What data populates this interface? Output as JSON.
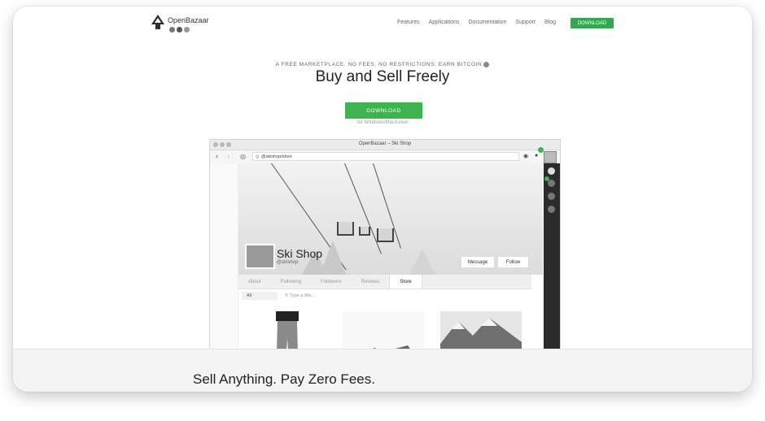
{
  "header": {
    "brand": "OpenBazaar",
    "nav": [
      "Features",
      "Applications",
      "Documentation",
      "Support",
      "Blog"
    ],
    "download_label": "DOWNLOAD"
  },
  "hero": {
    "tagline": "A FREE MARKETPLACE. NO FEES. NO RESTRICTIONS. EARN BITCOIN",
    "title": "Buy and Sell Freely",
    "download_label": "DOWNLOAD",
    "platforms": "for Windows/Mac/Linux"
  },
  "app": {
    "window_title": "OpenBazaar – Ski Shop",
    "address": "@skishop/store",
    "shop_name": "Ski Shop",
    "shop_handle": "@skishop",
    "message_label": "Message",
    "follow_label": "Follow",
    "tabs": [
      "About",
      "Following",
      "Followers",
      "Reviews",
      "Store"
    ],
    "active_tab": "Store",
    "filter_label": "All",
    "search_placeholder": "Type a title..."
  },
  "section": {
    "title": "Sell Anything. Pay Zero Fees."
  },
  "colors": {
    "accent_green": "#3eb34f",
    "sidebar_dark": "#2b2b2b"
  }
}
